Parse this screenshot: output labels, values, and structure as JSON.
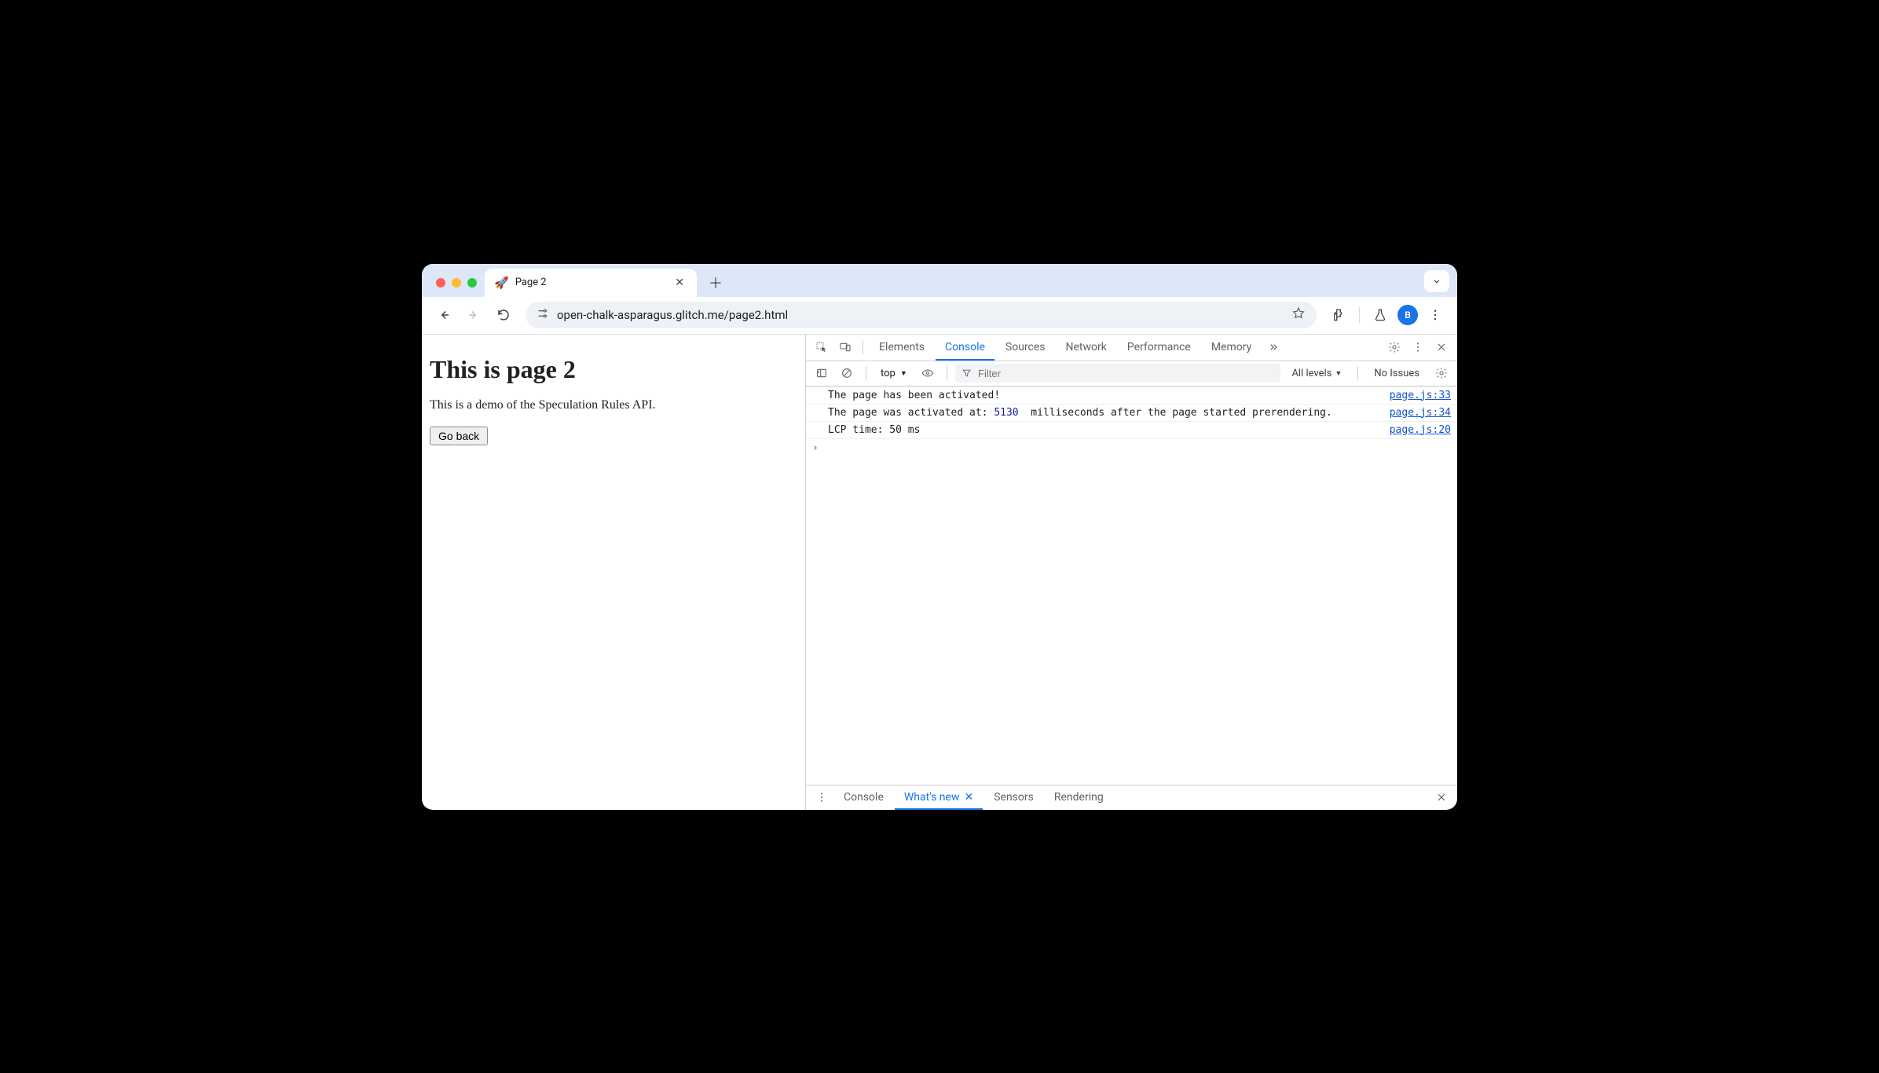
{
  "tab": {
    "favicon": "🚀",
    "title": "Page 2"
  },
  "address_bar": {
    "url": "open-chalk-asparagus.glitch.me/page2.html"
  },
  "profile": {
    "initial": "B"
  },
  "page": {
    "heading": "This is page 2",
    "paragraph": "This is a demo of the Speculation Rules API.",
    "button_label": "Go back"
  },
  "devtools": {
    "tabs": {
      "elements": "Elements",
      "console": "Console",
      "sources": "Sources",
      "network": "Network",
      "performance": "Performance",
      "memory": "Memory"
    },
    "filterbar": {
      "context": "top",
      "filter_placeholder": "Filter",
      "levels": "All levels",
      "issues": "No Issues"
    },
    "log": [
      {
        "text": "The page has been activated!",
        "num": "",
        "suffix": "",
        "src": "page.js:33"
      },
      {
        "text": "The page was activated at: ",
        "num": "5130",
        "suffix": "  milliseconds after the page started prerendering.",
        "src": "page.js:34"
      },
      {
        "text": "LCP time: 50 ms",
        "num": "",
        "suffix": "",
        "src": "page.js:20"
      }
    ],
    "prompt": "›",
    "drawer": {
      "console": "Console",
      "whatsnew": "What's new",
      "sensors": "Sensors",
      "rendering": "Rendering"
    }
  }
}
